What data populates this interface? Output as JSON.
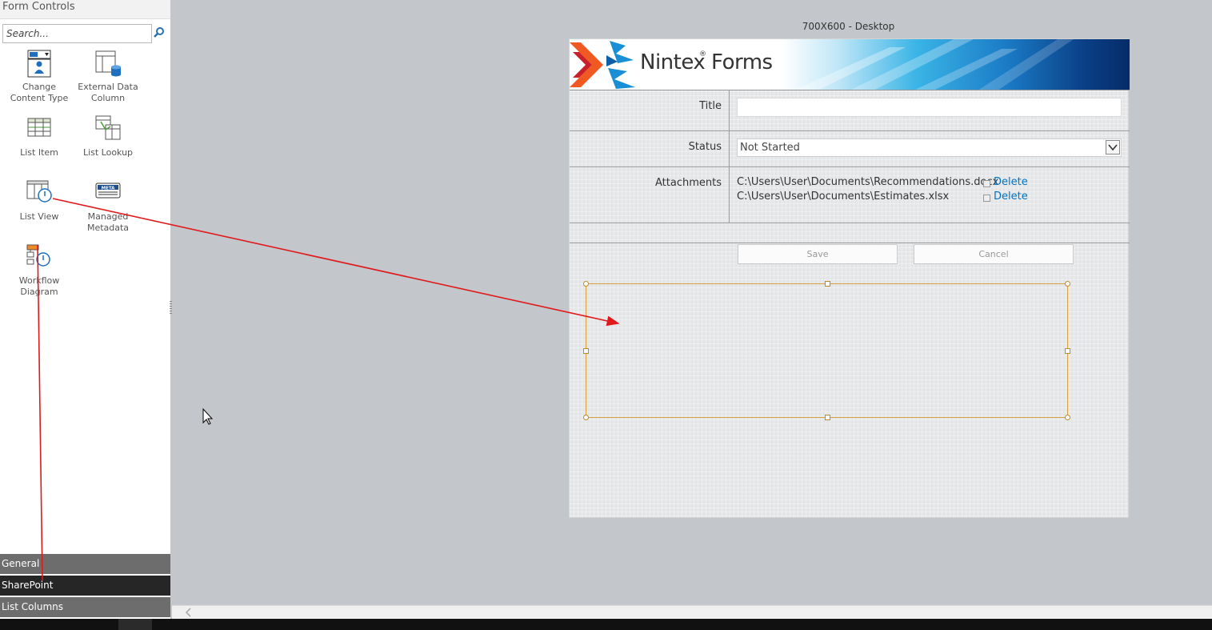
{
  "panel": {
    "title": "Form Controls",
    "search_placeholder": "Search...",
    "controls": [
      {
        "label": "Change Content Type"
      },
      {
        "label": "External Data Column"
      },
      {
        "label": "List Item"
      },
      {
        "label": "List Lookup"
      },
      {
        "label": "List View"
      },
      {
        "label": "Managed Metadata",
        "icon_text": "META"
      },
      {
        "label": "Workflow Diagram"
      }
    ],
    "categories": [
      {
        "label": "General",
        "color": "#6d6d6d"
      },
      {
        "label": "SharePoint",
        "color": "#262626"
      },
      {
        "label": "List Columns",
        "color": "#6d6d6d"
      }
    ]
  },
  "canvas": {
    "layout_label": "700X600 - Desktop",
    "brand": "Nintex Forms",
    "brand_mark": "®",
    "fields": {
      "title_label": "Title",
      "status_label": "Status",
      "status_value": "Not Started",
      "attachments_label": "Attachments",
      "attachments": [
        {
          "path": "C:\\Users\\User\\Documents\\Recommendations.docx",
          "action": "Delete"
        },
        {
          "path": "C:\\Users\\User\\Documents\\Estimates.xlsx",
          "action": "Delete"
        }
      ]
    },
    "buttons": {
      "save": "Save",
      "cancel": "Cancel"
    }
  },
  "colors": {
    "accent_link": "#0072c6",
    "annotation_arrow": "#e0191c",
    "selection_border": "#d7a23d"
  },
  "icons": {
    "search": "search-icon",
    "dropdown": "chevron-down-icon",
    "delete": "delete-icon",
    "cursor": "mouse-pointer-icon"
  }
}
